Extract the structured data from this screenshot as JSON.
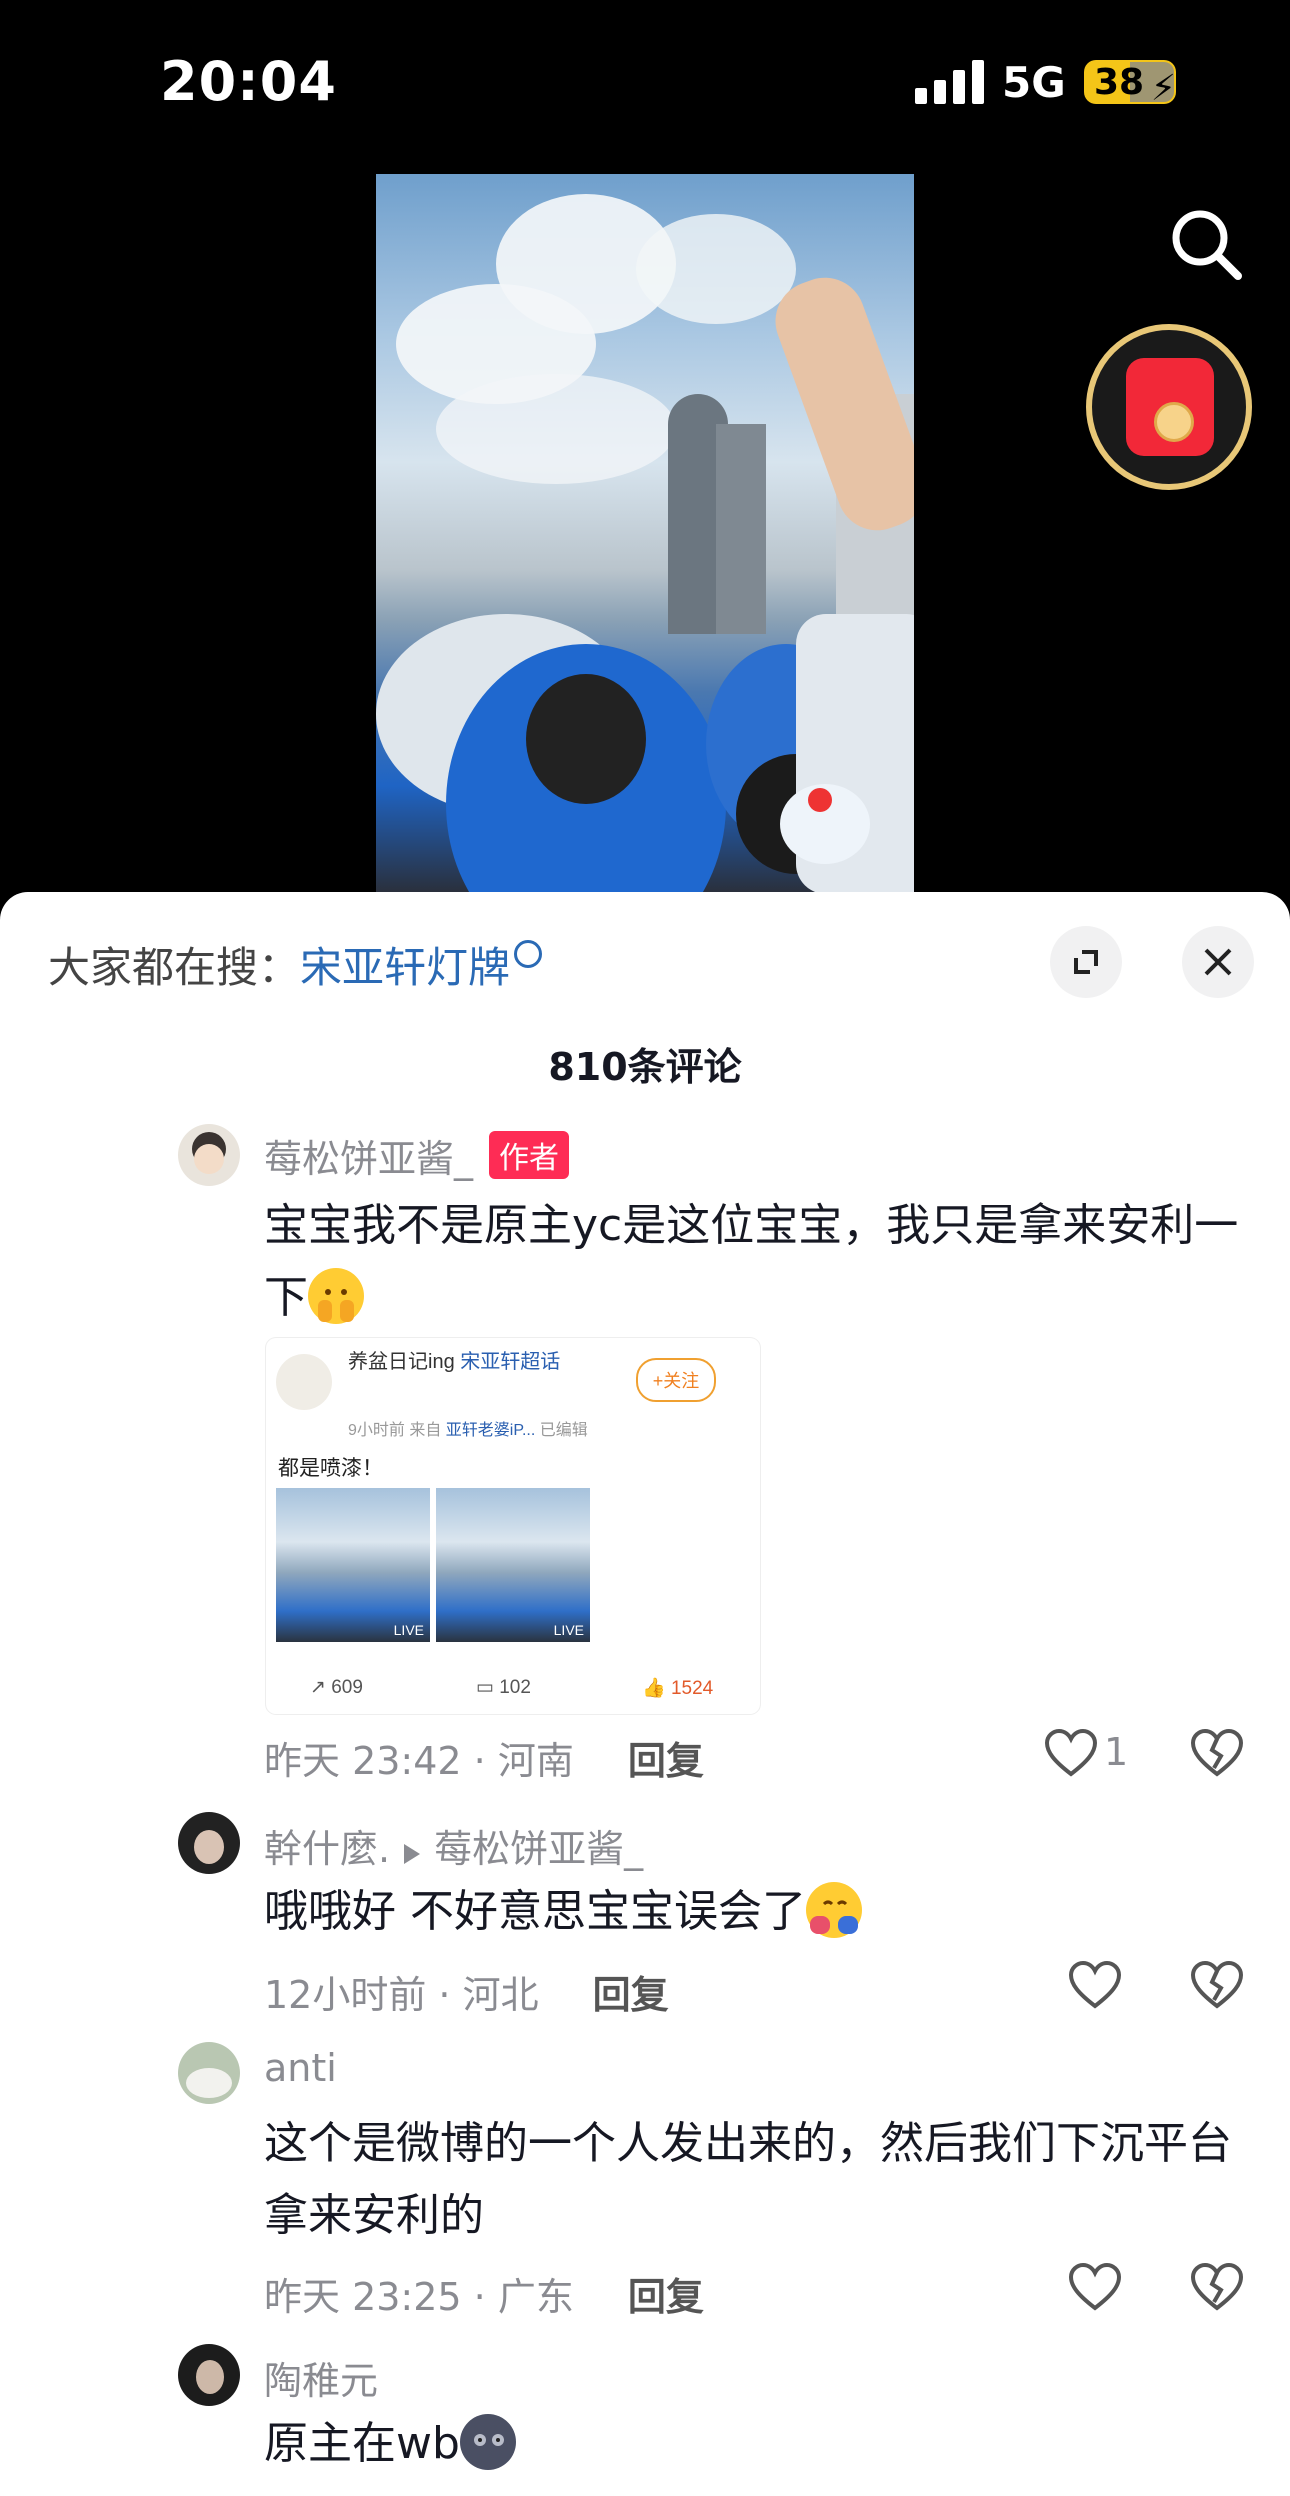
{
  "status_bar": {
    "time": "20:04",
    "network": "5G",
    "battery": "38"
  },
  "sheet": {
    "hot_search_prefix": "大家都在搜：",
    "hot_search_term": "宋亚轩灯牌",
    "comment_count": "810条评论"
  },
  "comments": [
    {
      "username": "莓松饼亚酱_",
      "tag": "作者",
      "text": "宝宝我不是原主yc是这位宝宝，我只是拿来安利一下",
      "time_location": "昨天 23:42 · 河南",
      "reply_label": "回复",
      "likes": "1",
      "emoji": "pleading-hands-emoji",
      "attachment": {
        "name": "养盆日记ing",
        "name_suffix": "宋亚轩超话",
        "follow": "+关注",
        "time_source_prefix": "9小时前  来自 ",
        "time_source_link": "亚轩老婆iP...",
        "time_source_suffix": "  已编辑",
        "text": "都是喷漆！",
        "live_label": "LIVE",
        "reposts": "609",
        "comments": "102",
        "likes": "1524"
      }
    },
    {
      "username": "幹什麼.",
      "reply_to": "莓松饼亚酱_",
      "text": "哦哦好 不好意思宝宝误会了",
      "time_location": "12小时前 · 河北",
      "reply_label": "回复",
      "emoji": "hugging-face-emoji"
    },
    {
      "username": "anti",
      "text": "这个是微博的一个人发出来的，然后我们下沉平台拿来安利的",
      "time_location": "昨天 23:25 · 广东",
      "reply_label": "回复"
    },
    {
      "username": "陶稚元",
      "text": "原主在wb",
      "emoji": "new-moon-face-emoji"
    }
  ],
  "colors": {
    "accent_red": "#fe2c55",
    "link_blue": "#2a6ab5",
    "battery_yellow": "#f4c518"
  }
}
